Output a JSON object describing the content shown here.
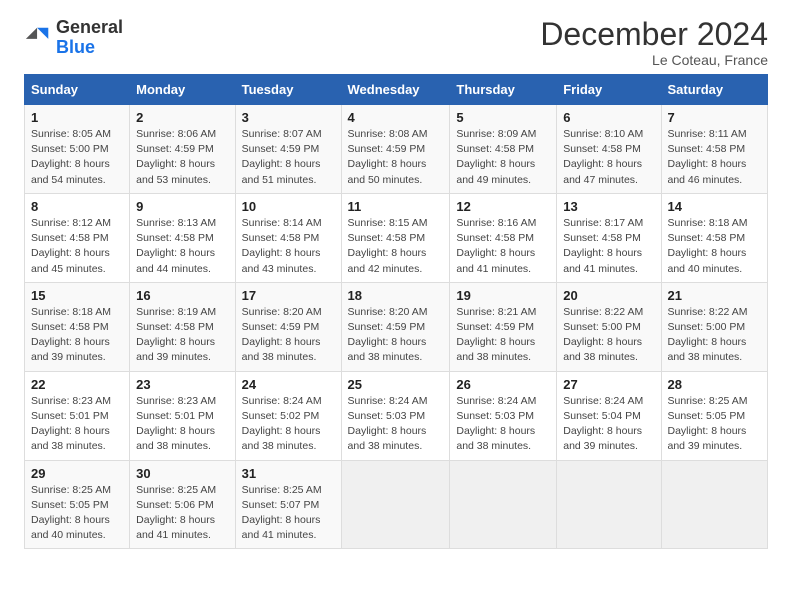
{
  "logo": {
    "general": "General",
    "blue": "Blue"
  },
  "title": "December 2024",
  "location": "Le Coteau, France",
  "weekdays": [
    "Sunday",
    "Monday",
    "Tuesday",
    "Wednesday",
    "Thursday",
    "Friday",
    "Saturday"
  ],
  "weeks": [
    [
      {
        "day": "1",
        "sunrise": "8:05 AM",
        "sunset": "5:00 PM",
        "daylight": "8 hours and 54 minutes."
      },
      {
        "day": "2",
        "sunrise": "8:06 AM",
        "sunset": "4:59 PM",
        "daylight": "8 hours and 53 minutes."
      },
      {
        "day": "3",
        "sunrise": "8:07 AM",
        "sunset": "4:59 PM",
        "daylight": "8 hours and 51 minutes."
      },
      {
        "day": "4",
        "sunrise": "8:08 AM",
        "sunset": "4:59 PM",
        "daylight": "8 hours and 50 minutes."
      },
      {
        "day": "5",
        "sunrise": "8:09 AM",
        "sunset": "4:58 PM",
        "daylight": "8 hours and 49 minutes."
      },
      {
        "day": "6",
        "sunrise": "8:10 AM",
        "sunset": "4:58 PM",
        "daylight": "8 hours and 47 minutes."
      },
      {
        "day": "7",
        "sunrise": "8:11 AM",
        "sunset": "4:58 PM",
        "daylight": "8 hours and 46 minutes."
      }
    ],
    [
      {
        "day": "8",
        "sunrise": "8:12 AM",
        "sunset": "4:58 PM",
        "daylight": "8 hours and 45 minutes."
      },
      {
        "day": "9",
        "sunrise": "8:13 AM",
        "sunset": "4:58 PM",
        "daylight": "8 hours and 44 minutes."
      },
      {
        "day": "10",
        "sunrise": "8:14 AM",
        "sunset": "4:58 PM",
        "daylight": "8 hours and 43 minutes."
      },
      {
        "day": "11",
        "sunrise": "8:15 AM",
        "sunset": "4:58 PM",
        "daylight": "8 hours and 42 minutes."
      },
      {
        "day": "12",
        "sunrise": "8:16 AM",
        "sunset": "4:58 PM",
        "daylight": "8 hours and 41 minutes."
      },
      {
        "day": "13",
        "sunrise": "8:17 AM",
        "sunset": "4:58 PM",
        "daylight": "8 hours and 41 minutes."
      },
      {
        "day": "14",
        "sunrise": "8:18 AM",
        "sunset": "4:58 PM",
        "daylight": "8 hours and 40 minutes."
      }
    ],
    [
      {
        "day": "15",
        "sunrise": "8:18 AM",
        "sunset": "4:58 PM",
        "daylight": "8 hours and 39 minutes."
      },
      {
        "day": "16",
        "sunrise": "8:19 AM",
        "sunset": "4:58 PM",
        "daylight": "8 hours and 39 minutes."
      },
      {
        "day": "17",
        "sunrise": "8:20 AM",
        "sunset": "4:59 PM",
        "daylight": "8 hours and 38 minutes."
      },
      {
        "day": "18",
        "sunrise": "8:20 AM",
        "sunset": "4:59 PM",
        "daylight": "8 hours and 38 minutes."
      },
      {
        "day": "19",
        "sunrise": "8:21 AM",
        "sunset": "4:59 PM",
        "daylight": "8 hours and 38 minutes."
      },
      {
        "day": "20",
        "sunrise": "8:22 AM",
        "sunset": "5:00 PM",
        "daylight": "8 hours and 38 minutes."
      },
      {
        "day": "21",
        "sunrise": "8:22 AM",
        "sunset": "5:00 PM",
        "daylight": "8 hours and 38 minutes."
      }
    ],
    [
      {
        "day": "22",
        "sunrise": "8:23 AM",
        "sunset": "5:01 PM",
        "daylight": "8 hours and 38 minutes."
      },
      {
        "day": "23",
        "sunrise": "8:23 AM",
        "sunset": "5:01 PM",
        "daylight": "8 hours and 38 minutes."
      },
      {
        "day": "24",
        "sunrise": "8:24 AM",
        "sunset": "5:02 PM",
        "daylight": "8 hours and 38 minutes."
      },
      {
        "day": "25",
        "sunrise": "8:24 AM",
        "sunset": "5:03 PM",
        "daylight": "8 hours and 38 minutes."
      },
      {
        "day": "26",
        "sunrise": "8:24 AM",
        "sunset": "5:03 PM",
        "daylight": "8 hours and 38 minutes."
      },
      {
        "day": "27",
        "sunrise": "8:24 AM",
        "sunset": "5:04 PM",
        "daylight": "8 hours and 39 minutes."
      },
      {
        "day": "28",
        "sunrise": "8:25 AM",
        "sunset": "5:05 PM",
        "daylight": "8 hours and 39 minutes."
      }
    ],
    [
      {
        "day": "29",
        "sunrise": "8:25 AM",
        "sunset": "5:05 PM",
        "daylight": "8 hours and 40 minutes."
      },
      {
        "day": "30",
        "sunrise": "8:25 AM",
        "sunset": "5:06 PM",
        "daylight": "8 hours and 41 minutes."
      },
      {
        "day": "31",
        "sunrise": "8:25 AM",
        "sunset": "5:07 PM",
        "daylight": "8 hours and 41 minutes."
      },
      null,
      null,
      null,
      null
    ]
  ],
  "labels": {
    "sunrise": "Sunrise:",
    "sunset": "Sunset:",
    "daylight": "Daylight:"
  }
}
